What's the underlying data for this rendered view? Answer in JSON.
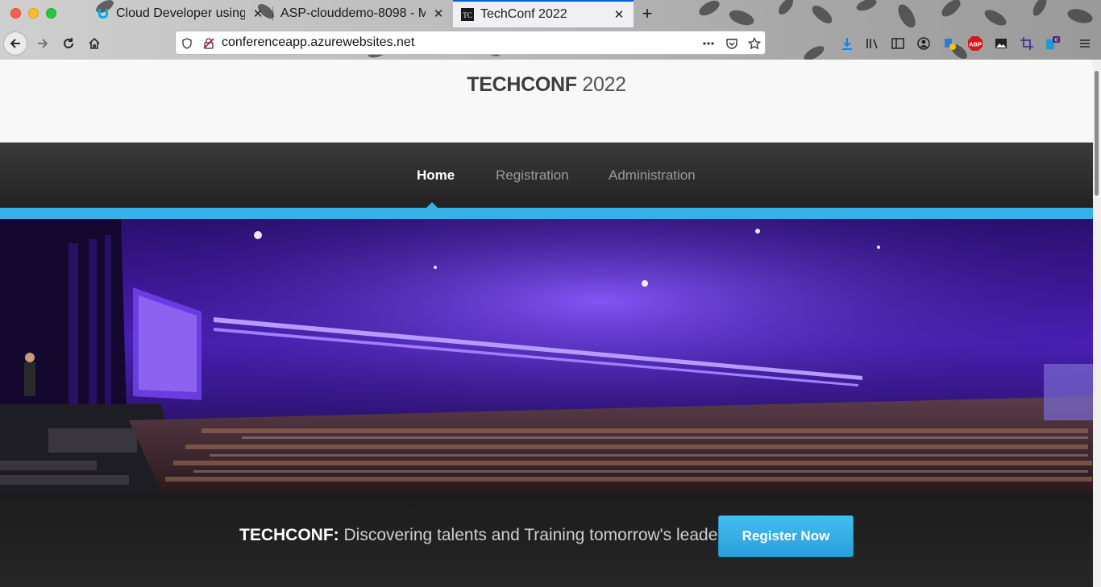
{
  "browser": {
    "tabs": [
      {
        "title": "Cloud Developer using",
        "active": false,
        "favicon": "udacity-icon"
      },
      {
        "title": "ASP-clouddemo-8098 - M",
        "active": false,
        "favicon": "none"
      },
      {
        "title": "TechConf 2022",
        "active": true,
        "favicon": "TC"
      }
    ],
    "url": "conferenceapp.azurewebsites.net",
    "abp_label": "ABP",
    "badge_count": "0",
    "colors": {
      "accent": "#0060df"
    }
  },
  "site": {
    "logo_bold": "TECHCONF",
    "logo_year": "2022",
    "nav": [
      {
        "label": "Home",
        "active": true
      },
      {
        "label": "Registration",
        "active": false
      },
      {
        "label": "Administration",
        "active": false
      }
    ],
    "cta": {
      "brand": "TECHCONF:",
      "tagline": " Discovering talents and Training tomorrow's leaders",
      "button": "Register Now"
    },
    "colors": {
      "accent": "#35b0e8",
      "nav_bg": "#2b2b2b",
      "hero_purple": "#4a1fb8"
    }
  }
}
